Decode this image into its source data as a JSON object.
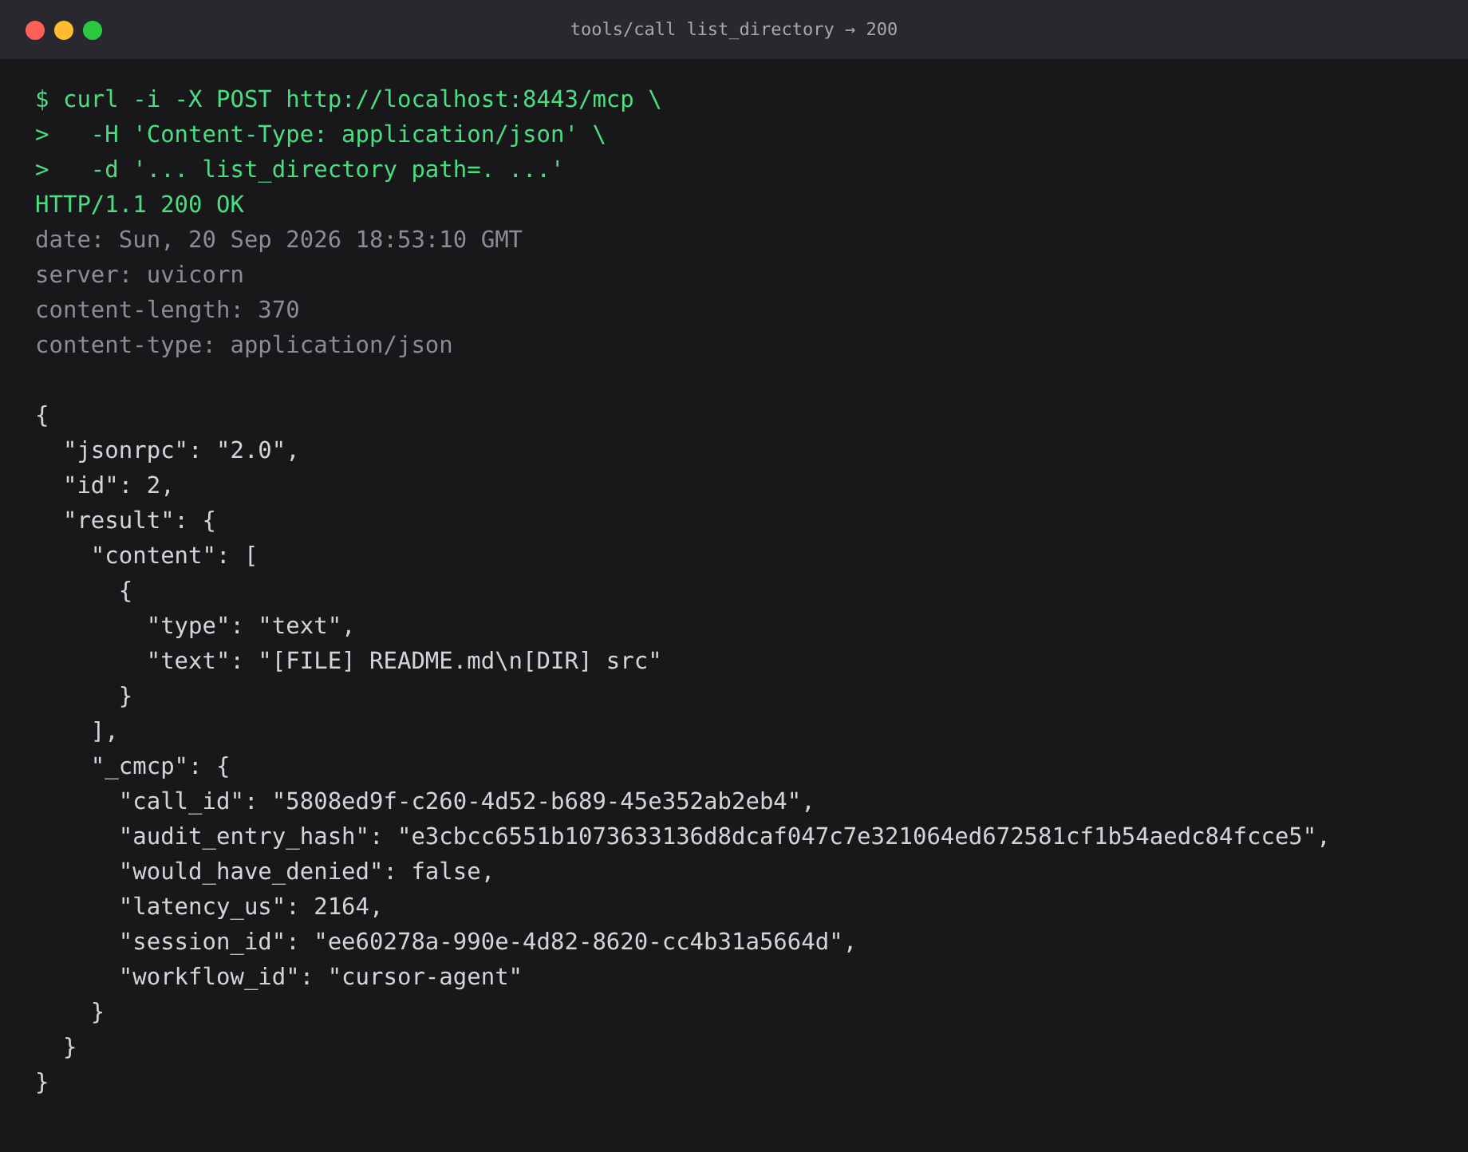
{
  "window": {
    "title": "tools/call list_directory → 200"
  },
  "lines": [
    {
      "kind": "command",
      "text": "$ curl -i -X POST http://localhost:8443/mcp \\"
    },
    {
      "kind": "command",
      "text": ">   -H 'Content-Type: application/json' \\"
    },
    {
      "kind": "command",
      "text": ">   -d '... list_directory path=. ...'"
    },
    {
      "kind": "status",
      "text": "HTTP/1.1 200 OK"
    },
    {
      "kind": "header",
      "text": "date: Sun, 20 Sep 2026 18:53:10 GMT"
    },
    {
      "kind": "header",
      "text": "server: uvicorn"
    },
    {
      "kind": "header",
      "text": "content-length: 370"
    },
    {
      "kind": "header",
      "text": "content-type: application/json"
    },
    {
      "kind": "blank"
    },
    {
      "kind": "body",
      "text": "{"
    },
    {
      "kind": "body",
      "text": "  \"jsonrpc\": \"2.0\","
    },
    {
      "kind": "body",
      "text": "  \"id\": 2,"
    },
    {
      "kind": "body",
      "text": "  \"result\": {"
    },
    {
      "kind": "body",
      "text": "    \"content\": ["
    },
    {
      "kind": "body",
      "text": "      {"
    },
    {
      "kind": "body",
      "text": "        \"type\": \"text\","
    },
    {
      "kind": "body",
      "text": "        \"text\": \"[FILE] README.md\\n[DIR] src\""
    },
    {
      "kind": "body",
      "text": "      }"
    },
    {
      "kind": "body",
      "text": "    ],"
    },
    {
      "kind": "body",
      "text": "    \"_cmcp\": {"
    },
    {
      "kind": "body",
      "text": "      \"call_id\": \"5808ed9f-c260-4d52-b689-45e352ab2eb4\","
    },
    {
      "kind": "body",
      "text": "      \"audit_entry_hash\": \"e3cbcc6551b1073633136d8dcaf047c7e321064ed672581cf1b54aedc84fcce5\","
    },
    {
      "kind": "body",
      "text": "      \"would_have_denied\": false,"
    },
    {
      "kind": "body",
      "text": "      \"latency_us\": 2164,"
    },
    {
      "kind": "body",
      "text": "      \"session_id\": \"ee60278a-990e-4d82-8620-cc4b31a5664d\","
    },
    {
      "kind": "body",
      "text": "      \"workflow_id\": \"cursor-agent\""
    },
    {
      "kind": "body",
      "text": "    }"
    },
    {
      "kind": "body",
      "text": "  }"
    },
    {
      "kind": "body",
      "text": "}"
    }
  ]
}
